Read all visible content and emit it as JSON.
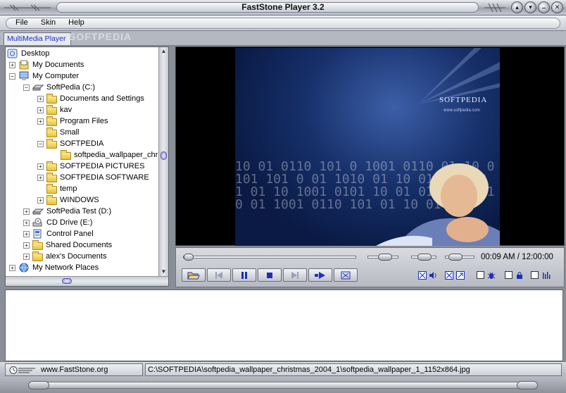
{
  "window": {
    "title": "FastStone Player 3.2",
    "buttons": [
      "▴",
      "▾",
      "–",
      "✕"
    ]
  },
  "menu": {
    "items": [
      "File",
      "Skin",
      "Help"
    ]
  },
  "tab": {
    "label": "MultiMedia Player"
  },
  "watermark": {
    "text": "SOFTPEDIA",
    "sub": "www.softpedia.com"
  },
  "tree": {
    "items": [
      {
        "label": "Desktop",
        "depth": 0,
        "expander": "",
        "icon": "desktop-icon"
      },
      {
        "label": "My Documents",
        "depth": 1,
        "expander": "+",
        "icon": "my-documents-icon"
      },
      {
        "label": "My Computer",
        "depth": 1,
        "expander": "−",
        "icon": "my-computer-icon"
      },
      {
        "label": "SoftPedia (C:)",
        "depth": 2,
        "expander": "−",
        "icon": "hard-drive-icon"
      },
      {
        "label": "Documents and Settings",
        "depth": 3,
        "expander": "+",
        "icon": "folder-icon"
      },
      {
        "label": "kav",
        "depth": 3,
        "expander": "+",
        "icon": "folder-icon"
      },
      {
        "label": "Program Files",
        "depth": 3,
        "expander": "+",
        "icon": "folder-icon"
      },
      {
        "label": "Small",
        "depth": 3,
        "expander": "",
        "icon": "folder-icon"
      },
      {
        "label": "SOFTPEDIA",
        "depth": 3,
        "expander": "−",
        "icon": "folder-icon"
      },
      {
        "label": "softpedia_wallpaper_chr",
        "depth": 4,
        "expander": "",
        "icon": "folder-icon"
      },
      {
        "label": "SOFTPEDIA PICTURES",
        "depth": 3,
        "expander": "+",
        "icon": "folder-icon"
      },
      {
        "label": "SOFTPEDIA SOFTWARE",
        "depth": 3,
        "expander": "+",
        "icon": "folder-icon"
      },
      {
        "label": "temp",
        "depth": 3,
        "expander": "",
        "icon": "folder-icon"
      },
      {
        "label": "WINDOWS",
        "depth": 3,
        "expander": "+",
        "icon": "folder-icon"
      },
      {
        "label": "SoftPedia Test (D:)",
        "depth": 2,
        "expander": "+",
        "icon": "hard-drive-icon"
      },
      {
        "label": "CD Drive (E:)",
        "depth": 2,
        "expander": "+",
        "icon": "cd-drive-icon"
      },
      {
        "label": "Control Panel",
        "depth": 2,
        "expander": "+",
        "icon": "control-panel-icon"
      },
      {
        "label": "Shared Documents",
        "depth": 2,
        "expander": "+",
        "icon": "folder-icon"
      },
      {
        "label": "alex's Documents",
        "depth": 2,
        "expander": "+",
        "icon": "folder-icon"
      },
      {
        "label": "My Network Places",
        "depth": 1,
        "expander": "+",
        "icon": "network-places-icon"
      }
    ]
  },
  "video": {
    "brand": "SOFTPEDIA",
    "brand_sub": "www.softpedia.com"
  },
  "player": {
    "time": "00:09 AM / 12:00:00",
    "seek_fraction": 0.0,
    "buttons": [
      {
        "name": "open-file-button",
        "icon": "folder-open-icon"
      },
      {
        "name": "previous-button",
        "icon": "skip-back-icon"
      },
      {
        "name": "pause-button",
        "icon": "pause-icon"
      },
      {
        "name": "stop-button",
        "icon": "stop-icon"
      },
      {
        "name": "next-button",
        "icon": "skip-forward-icon"
      },
      {
        "name": "play-next-button",
        "icon": "play-step-icon"
      },
      {
        "name": "fullscreen-button",
        "icon": "fullscreen-icon"
      }
    ]
  },
  "status": {
    "website": "www.FastStone.org",
    "path": "C:\\SOFTPEDIA\\softpedia_wallpaper_christmas_2004_1\\softpedia_wallpaper_1_1152x864.jpg"
  },
  "colors": {
    "accent": "#1530c8",
    "toolbar_icon": "#1d2fb8"
  }
}
